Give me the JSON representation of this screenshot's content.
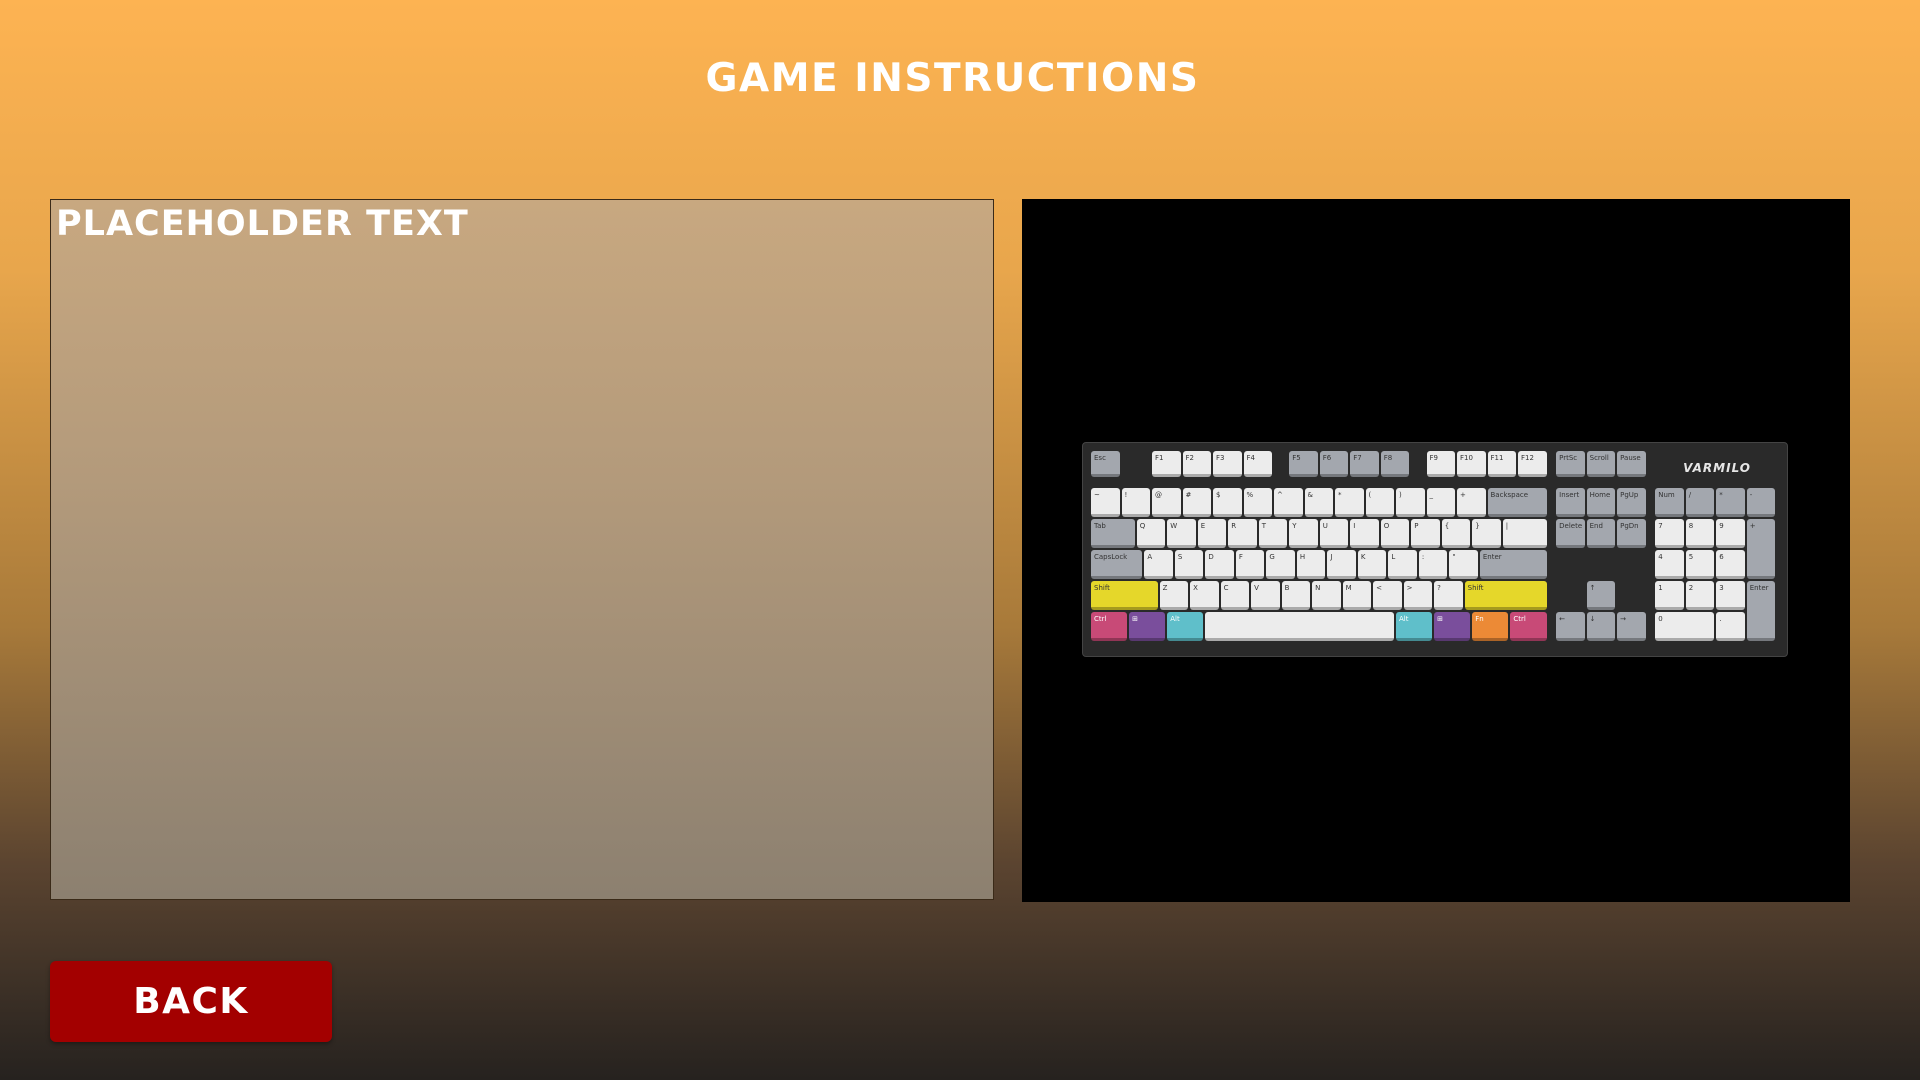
{
  "header": {
    "title": "GAME INSTRUCTIONS"
  },
  "instructions": {
    "text": "PLACEHOLDER TEXT"
  },
  "image": {
    "description_icon": "keyboard-image",
    "brand": "VARMILO"
  },
  "footer": {
    "back_label": "BACK"
  },
  "colors": {
    "background_top": "#fdb352",
    "background_bottom": "#26221f",
    "back_button": "#a30000",
    "panel": "#c8a880"
  }
}
